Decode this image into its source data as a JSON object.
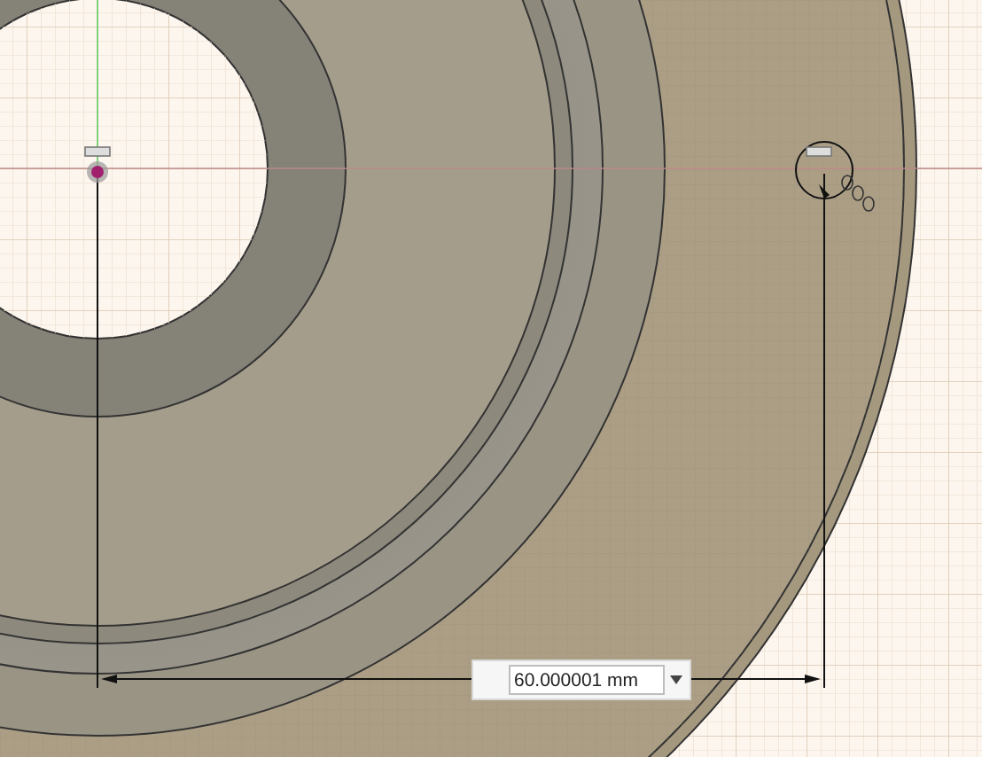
{
  "dimension_input": {
    "value": "60.000001 mm"
  }
}
